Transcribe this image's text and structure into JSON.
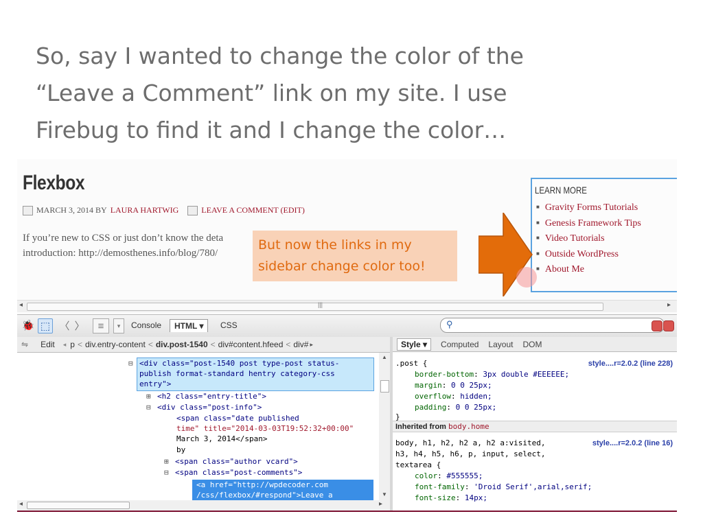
{
  "slide": {
    "lines": [
      "So, say I wanted to change the color of the",
      "“Leave a Comment” link on my site.  I use",
      "Firebug to find it and I change the color…"
    ]
  },
  "site": {
    "title": "Flexbox",
    "meta_date": "MARCH 3, 2014 BY",
    "meta_author": "LAURA HARTWIG",
    "meta_comment": "LEAVE A COMMENT (EDIT)",
    "excerpt_line1": "If you’re new to CSS or just don’t know the deta",
    "excerpt_line2": "introduction: http://demosthenes.info/blog/780/"
  },
  "sidebar": {
    "heading": "LEARN MORE",
    "items": [
      "Gravity Forms Tutorials",
      "Genesis Framework Tips",
      "Video Tutorials",
      "Outside WordPress",
      "About Me"
    ]
  },
  "callout": {
    "line1": "But now the links in my",
    "line2": "sidebar change color too!"
  },
  "firebug": {
    "tabs": {
      "console": "Console",
      "html": "HTML ▾",
      "css": "CSS"
    },
    "breadcrumb": {
      "edit": "Edit",
      "items": [
        "p",
        "div.entry-content",
        "div.post-1540",
        "div#content.hfeed",
        "div#"
      ]
    },
    "side_tabs": {
      "style": "Style ▾",
      "computed": "Computed",
      "layout": "Layout",
      "dom": "DOM"
    },
    "html_lines": [
      "<div class=\"post-1540 post type-post status-",
      "publish format-standard hentry category-css",
      "entry\">",
      "<h2 class=\"entry-title\">",
      "<div class=\"post-info\">",
      "<span class=\"date published",
      "time\" title=\"2014-03-03T19:52:32+00:00\"",
      "March 3, 2014</span>",
      "by",
      "<span class=\"author vcard\">",
      "<span class=\"post-comments\">",
      "<a href=\"http://wpdecoder.com",
      "/css/flexbox/#respond\">Leave a"
    ],
    "css": {
      "rule1_selector": ".post {",
      "rule1_source": "style....r=2.0.2 (line 228)",
      "rule1_decls": [
        {
          "prop": "border-bottom",
          "val": "3px double #EEEEEE;"
        },
        {
          "prop": "margin",
          "val": "0 0 25px;"
        },
        {
          "prop": "overflow",
          "val": "hidden;"
        },
        {
          "prop": "padding",
          "val": "0 0 25px;"
        }
      ],
      "rule1_close": "}",
      "inherited_label": "Inherited from",
      "inherited_from": "body.home",
      "rule2_selector_1": "body, h1, h2, h2 a, h2 a:visited,",
      "rule2_selector_2": "h3, h4, h5, h6, p, input, select,",
      "rule2_selector_3": "textarea {",
      "rule2_source": "style....r=2.0.2 (line 16)",
      "rule2_decls": [
        {
          "prop": "color",
          "val": "#555555;"
        },
        {
          "prop": "font-family",
          "val": "'Droid Serif',arial,serif;"
        },
        {
          "prop": "font-size",
          "val": "14px;"
        }
      ]
    }
  },
  "colors": {
    "link": "#a0182c",
    "arrow": "#e36c0a",
    "callout_bg": "#f9d2b7",
    "selection": "#3a8ee6",
    "highlight": "#c7e8fb"
  }
}
